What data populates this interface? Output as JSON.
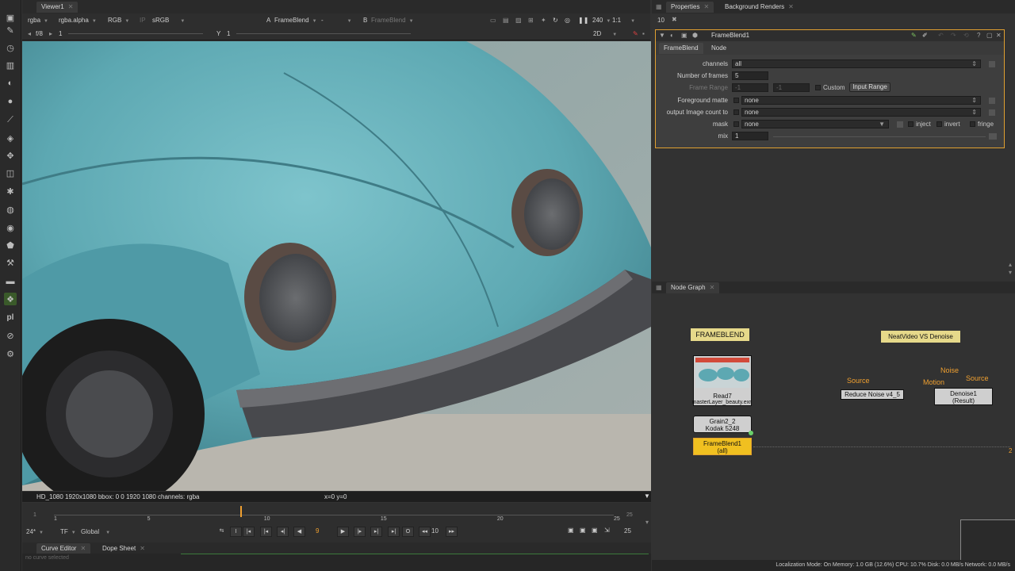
{
  "viewer": {
    "tab_label": "Viewer1",
    "channels": "rgba",
    "alpha": "rgba.alpha",
    "color": "RGB",
    "ip": "IP",
    "lut": "sRGB",
    "input_a_letter": "A",
    "input_a": "FrameBlend",
    "input_a_op": "-",
    "input_b_letter": "B",
    "input_b": "FrameBlend",
    "zoom": "240",
    "ratio": "1:1",
    "fstop": "f/8",
    "gain": "1",
    "gamma_label": "Y",
    "gamma": "1",
    "view_mode": "2D",
    "info_bar": "HD_1080 1920x1080  bbox: 0 0 1920 1080 channels: rgba",
    "coords": "x=0 y=0"
  },
  "timeline": {
    "start": "1",
    "end": "25",
    "ticks": [
      "1",
      "5",
      "10",
      "15",
      "20",
      "25"
    ],
    "fps": "24*",
    "tf": "TF",
    "range": "Global",
    "current_frame": "9",
    "step": "10",
    "end_frame": "25",
    "playhead_frac": 0.333
  },
  "bottom_tabs": {
    "curve_editor": "Curve Editor",
    "dope_sheet": "Dope Sheet",
    "no_curve": "no curve selected"
  },
  "properties": {
    "tab_label": "Properties",
    "bg_renders_label": "Background Renders",
    "max_panels": "10",
    "node_name": "FrameBlend1",
    "subtab_main": "FrameBlend",
    "subtab_node": "Node",
    "channels_label": "channels",
    "channels_value": "all",
    "num_frames_label": "Number of frames",
    "num_frames_value": "5",
    "frame_range_label": "Frame Range",
    "frame_range_a": "-1",
    "frame_range_b": "-1",
    "custom_label": "Custom",
    "input_range_label": "Input Range",
    "fg_matte_label": "Foreground matte",
    "fg_matte_value": "none",
    "output_count_label": "output Image count to",
    "output_count_value": "none",
    "mask_label": "mask",
    "mask_value": "none",
    "inject_label": "inject",
    "invert_label": "invert",
    "fringe_label": "fringe",
    "mix_label": "mix",
    "mix_value": "1"
  },
  "node_graph": {
    "tab_label": "Node Graph",
    "backdrop1": "FRAMEBLEND",
    "backdrop2": "NeatVideo VS Denoise",
    "read_label": "Read7",
    "read_file": "masterLayer_beauty.exr",
    "grain_label1": "Grain2_2",
    "grain_label2": "Kodak 5248",
    "frameblend_label1": "FrameBlend1",
    "frameblend_label2": "(all)",
    "source1": "Source",
    "reduce_noise": "Reduce Noise v4_5",
    "noise_label": "Noise",
    "motion_label": "Motion",
    "source2": "Source",
    "denoise_label1": "Denoise1",
    "denoise_label2": "(Result)",
    "edge_num": "2"
  },
  "status_bar": "Localization Mode: On  Memory: 1.0 GB (12.6%)  CPU: 10.7%  Disk: 0.0 MB/s  Network: 0.0 MB/s"
}
